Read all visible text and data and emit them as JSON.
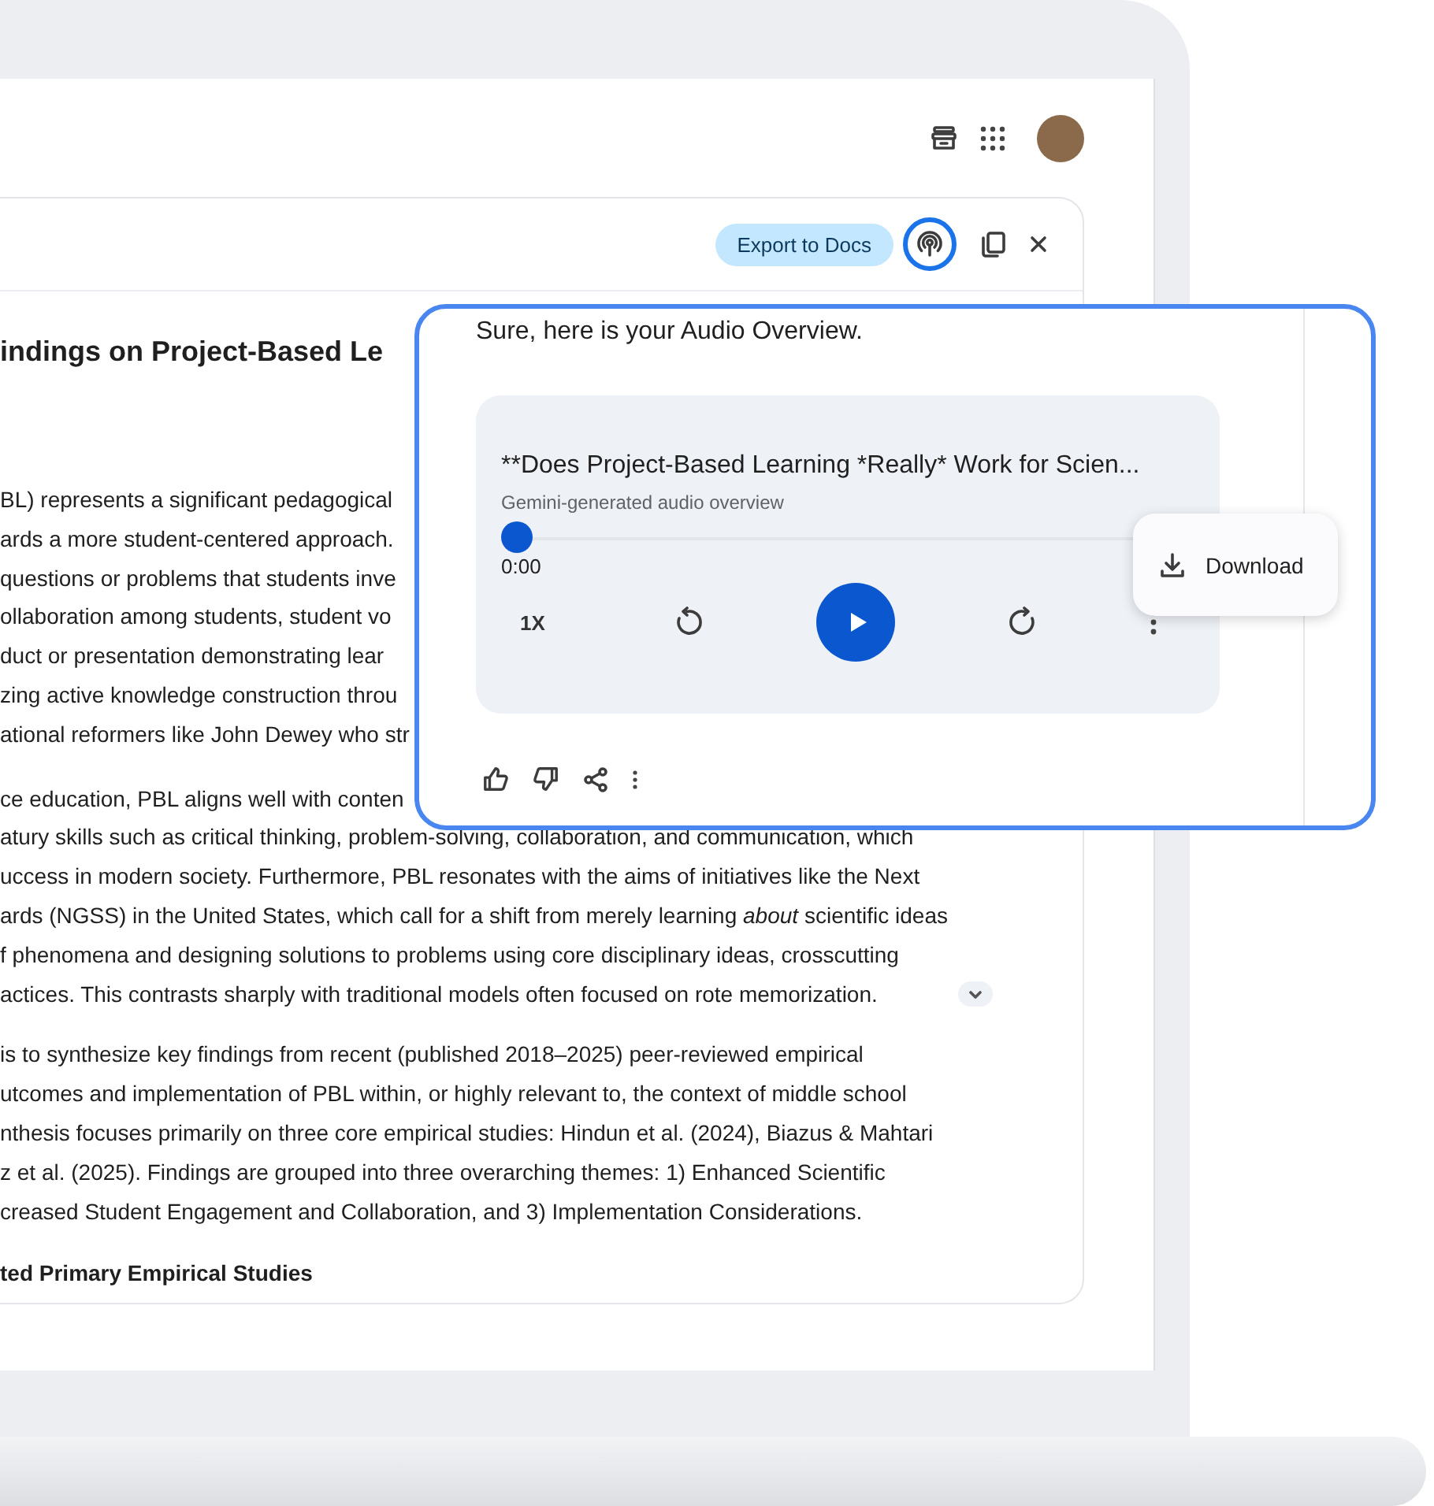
{
  "document": {
    "toolbar": {
      "export_button": "Export to Docs",
      "audio_button": {
        "selected": true
      }
    },
    "title": "indings on Project-Based Le",
    "paragraphs": [
      {
        "expandable": false,
        "lines": [
          "BL) represents a significant pedagogical",
          "ards a more student-centered approach.",
          "questions or problems that students inve",
          "ollaboration among students, student vo",
          "duct or presentation demonstrating lear",
          "zing active knowledge construction throu",
          "ational reformers like John Dewey who str"
        ]
      },
      {
        "expandable": true,
        "lines": [
          "ce education, PBL aligns well with conten",
          "atury skills such as critical thinking, problem-solving, collaboration, and communication, which",
          "uccess in modern society. Furthermore, PBL resonates with the aims of initiatives like the Next",
          "ards (NGSS) in the United States, which call for a shift from merely learning *about* scientific ideas",
          "f phenomena and designing solutions to problems using core disciplinary ideas, crosscutting",
          "actices. This contrasts sharply with traditional models often focused on rote memorization."
        ]
      },
      {
        "expandable": false,
        "lines": [
          "is to synthesize key findings from recent (published 2018–2025) peer-reviewed empirical",
          "utcomes and implementation of PBL within, or highly relevant to, the context of middle school",
          "nthesis focuses primarily on three core empirical studies: Hindun et al. (2024), Biazus & Mahtari",
          "z et al. (2025). Findings are grouped into three overarching themes: 1) Enhanced Scientific",
          "creased Student Engagement and Collaboration, and 3) Implementation Considerations."
        ]
      }
    ],
    "heading": "ted Primary Empirical Studies"
  },
  "popup": {
    "intro": "Sure, here is your Audio Overview.",
    "player": {
      "title": "**Does Project-Based Learning *Really* Work for Scien...",
      "subtitle": "Gemini-generated audio overview",
      "progress": {
        "level": 0
      },
      "time": "0:00",
      "speed": "1X",
      "playing": false
    },
    "menu": {
      "items": [
        {
          "label": "Download"
        }
      ]
    }
  }
}
